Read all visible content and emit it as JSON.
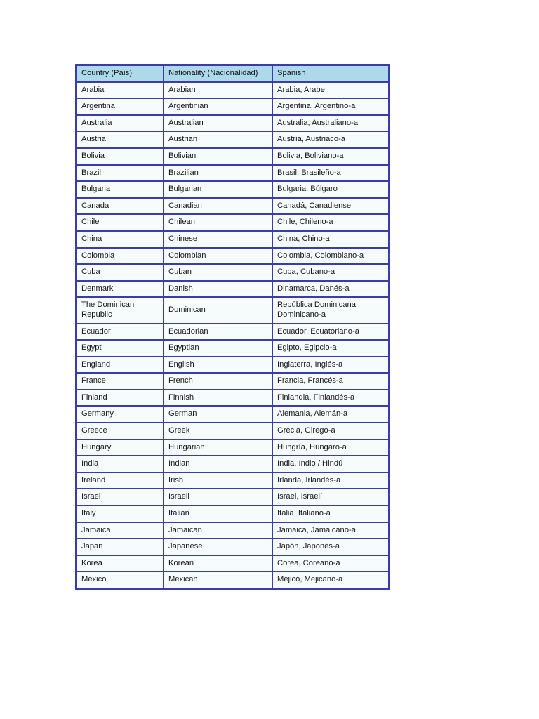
{
  "document": {
    "type": "table-document",
    "background_color": "#ffffff"
  },
  "table": {
    "name": "countries-nationalities-table",
    "header_background": "#aed9e8",
    "cell_background": "#f6fbfb",
    "border_color": "#3b3bab",
    "columns": [
      "Country (País)",
      "Nationality (Nacionalidad)",
      "Spanish"
    ],
    "rows": [
      {
        "country": "Arabia",
        "nationality": "Arabian",
        "spanish": "Arabia, Arabe",
        "tall": false
      },
      {
        "country": "Argentina",
        "nationality": "Argentinian",
        "spanish": "Argentina, Argentino-a",
        "tall": false
      },
      {
        "country": "Australia",
        "nationality": "Australian",
        "spanish": "Australia, Australiano-a",
        "tall": false
      },
      {
        "country": "Austria",
        "nationality": "Austrian",
        "spanish": "Austria, Austriaco-a",
        "tall": false
      },
      {
        "country": "Bolivia",
        "nationality": "Bolivian",
        "spanish": "Bolivia, Boliviano-a",
        "tall": false
      },
      {
        "country": "Brazil",
        "nationality": "Brazilian",
        "spanish": "Brasil, Brasileño-a",
        "tall": false
      },
      {
        "country": "Bulgaria",
        "nationality": "Bulgarian",
        "spanish": "Bulgaria, Búlgaro",
        "tall": false
      },
      {
        "country": "Canada",
        "nationality": "Canadian",
        "spanish": "Canadá, Canadiense",
        "tall": false
      },
      {
        "country": "Chile",
        "nationality": "Chilean",
        "spanish": "Chile, Chileno-a",
        "tall": false
      },
      {
        "country": "China",
        "nationality": "Chinese",
        "spanish": "China, Chino-a",
        "tall": false
      },
      {
        "country": "Colombia",
        "nationality": "Colombian",
        "spanish": "Colombia, Colombiano-a",
        "tall": false
      },
      {
        "country": "Cuba",
        "nationality": "Cuban",
        "spanish": "Cuba, Cubano-a",
        "tall": false
      },
      {
        "country": "Denmark",
        "nationality": "Danish",
        "spanish": "Dinamarca, Danés-a",
        "tall": false
      },
      {
        "country": "The Dominican Republic",
        "nationality": "Dominican",
        "spanish": "República Dominicana, Dominicano-a",
        "tall": true
      },
      {
        "country": "Ecuador",
        "nationality": "Ecuadorian",
        "spanish": "Ecuador, Ecuatoriano-a",
        "tall": false
      },
      {
        "country": "Egypt",
        "nationality": "Egyptian",
        "spanish": "Egipto, Egipcio-a",
        "tall": false
      },
      {
        "country": "England",
        "nationality": "English",
        "spanish": "Inglaterra, Inglés-a",
        "tall": false
      },
      {
        "country": "France",
        "nationality": "French",
        "spanish": "Francia, Francés-a",
        "tall": false
      },
      {
        "country": "Finland",
        "nationality": "Finnish",
        "spanish": "Finlandia, Finlandés-a",
        "tall": false
      },
      {
        "country": "Germany",
        "nationality": "German",
        "spanish": "Alemania, Alemán-a",
        "tall": false
      },
      {
        "country": "Greece",
        "nationality": "Greek",
        "spanish": "Grecia, Girego-a",
        "tall": false
      },
      {
        "country": "Hungary",
        "nationality": "Hungarian",
        "spanish": "Hungría, Húngaro-a",
        "tall": false
      },
      {
        "country": "India",
        "nationality": "Indian",
        "spanish": "India, Indio / Hindú",
        "tall": false
      },
      {
        "country": "Ireland",
        "nationality": "Irish",
        "spanish": "Irlanda, Irlandés-a",
        "tall": false
      },
      {
        "country": "Israel",
        "nationality": "Israeli",
        "spanish": "Israel, Israelí",
        "tall": false
      },
      {
        "country": "Italy",
        "nationality": "Italian",
        "spanish": "Italia, Italiano-a",
        "tall": false
      },
      {
        "country": "Jamaica",
        "nationality": "Jamaican",
        "spanish": "Jamaica, Jamaicano-a",
        "tall": false
      },
      {
        "country": "Japan",
        "nationality": "Japanese",
        "spanish": "Japón, Japonés-a",
        "tall": false
      },
      {
        "country": "Korea",
        "nationality": "Korean",
        "spanish": "Corea, Coreano-a",
        "tall": false
      },
      {
        "country": "Mexico",
        "nationality": "Mexican",
        "spanish": "Méjico, Mejicano-a",
        "tall": false
      }
    ]
  }
}
